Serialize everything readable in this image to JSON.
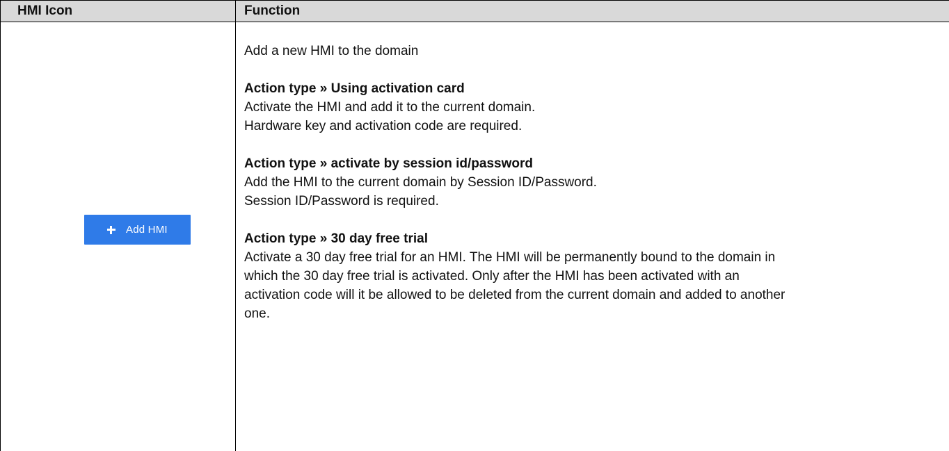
{
  "table": {
    "headers": {
      "icon": "HMI Icon",
      "function": "Function"
    }
  },
  "button": {
    "label": "Add HMI",
    "icon": "plus-icon",
    "color": "#2f7be8"
  },
  "function": {
    "intro": "Add a new HMI to the domain",
    "sections": [
      {
        "heading": "Action type » Using activation card",
        "lines": [
          "Activate the HMI and add it to the current domain.",
          "Hardware key and activation code are required."
        ]
      },
      {
        "heading": "Action type » activate by session id/password",
        "lines": [
          "Add the HMI to the current domain by Session ID/Password.",
          "Session ID/Password is required."
        ]
      },
      {
        "heading": "Action type » 30 day free trial",
        "lines": [
          "Activate a 30 day free trial for an HMI.  The HMI will be permanently bound to the domain in which the 30 day free trial is activated.  Only after the HMI has been activated with an activation code will it be allowed to be deleted from the current domain and added to another one."
        ]
      }
    ]
  }
}
